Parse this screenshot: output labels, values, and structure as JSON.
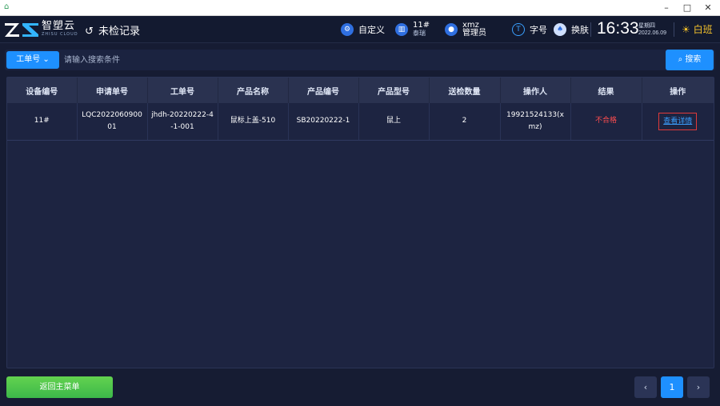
{
  "window": {
    "minimize": "–",
    "maximize": "□",
    "close": "✕"
  },
  "header": {
    "brand_cn": "智塑云",
    "brand_en": "ZHISU CLOUD",
    "record_label": "未检记录",
    "custom_label": "自定义",
    "station_number": "11#",
    "station_sub": "泰瑞",
    "user_name": "xmz",
    "user_role": "管理员",
    "font_label": "字号",
    "skin_label": "换肤",
    "time": "16:33",
    "weekday": "星期四",
    "date": "2022.06.09",
    "shift": "白班"
  },
  "search": {
    "type_label": "工单号",
    "placeholder": "请输入搜索条件",
    "search_label": "搜索"
  },
  "table": {
    "headers": [
      "设备编号",
      "申请单号",
      "工单号",
      "产品名称",
      "产品编号",
      "产品型号",
      "送检数量",
      "操作人",
      "结果",
      "操作"
    ],
    "rows": [
      {
        "device": "11#",
        "apply_no": "LQC202206090001",
        "order_no": "jhdh-20220222-4-1-001",
        "product_name": "鼠标上盖-510",
        "product_no": "SB20220222-1",
        "model": "鼠上",
        "qty": "2",
        "operator": "19921524133(xmz)",
        "result": "不合格",
        "action": "查看详情"
      }
    ]
  },
  "footer": {
    "back_label": "返回主菜单",
    "prev": "‹",
    "page": "1",
    "next": "›"
  },
  "colors": {
    "accent": "#1e90ff",
    "fail": "#ff4d4f",
    "shift": "#f6c32b",
    "back": "#4cc44a"
  }
}
